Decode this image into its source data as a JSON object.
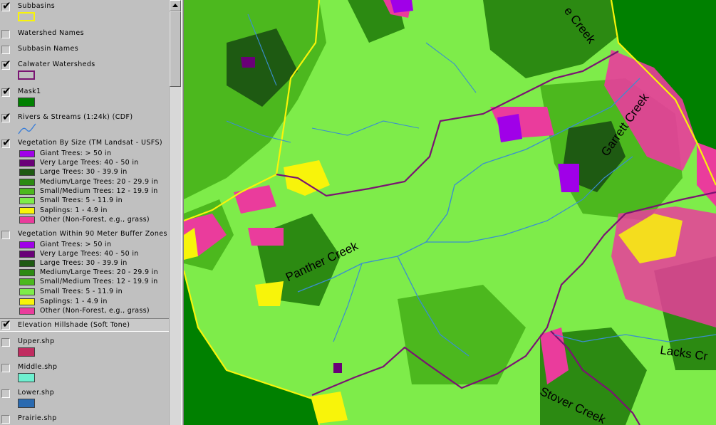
{
  "colors": {
    "giant": "#a000e8",
    "very_large": "#6a0078",
    "large": "#1e5a12",
    "medium_large": "#2c8a12",
    "small_medium": "#4cb81e",
    "small": "#7eec4a",
    "saplings": "#f8f40a",
    "other": "#ea3c9c",
    "watershed_line": "#7a1472",
    "subbasin_line": "#f8f40a",
    "mask": "#008000",
    "upper": "#c02c60",
    "middle": "#6ef0d0",
    "lower": "#2a6ab0"
  },
  "legend": {
    "subbasins": "Subbasins",
    "watershed_names": "Watershed Names",
    "subbasin_names": "Subbasin Names",
    "calwater": "Calwater Watersheds",
    "mask1": "Mask1",
    "rivers": "Rivers & Streams (1:24k) (CDF)",
    "veg_by_size": "Vegetation By Size (TM Landsat - USFS)",
    "veg_buffer": "Vegetation Within 90 Meter Buffer Zones",
    "hillshade": "Elevation Hillshade (Soft Tone)",
    "upper": "Upper.shp",
    "middle": "Middle.shp",
    "lower": "Lower.shp",
    "prairie": "Prairie.shp",
    "classes": [
      "Giant Trees: > 50 in",
      "Very Large Trees: 40 - 50 in",
      "Large Trees: 30 - 39.9 in",
      "Medium/Large Trees: 20 - 29.9 in",
      "Small/Medium Trees: 12 - 19.9 in",
      "Small Trees: 5 - 11.9 in",
      "Saplings: 1 - 4.9 in",
      "Other (Non-Forest, e.g., grass)"
    ]
  },
  "map": {
    "labels": {
      "top_creek": "e Creek",
      "garrett": "Garrett Creek",
      "panther": "Panther Creek",
      "lacks": "Lacks Cr",
      "stover": "Stover Creek"
    }
  }
}
